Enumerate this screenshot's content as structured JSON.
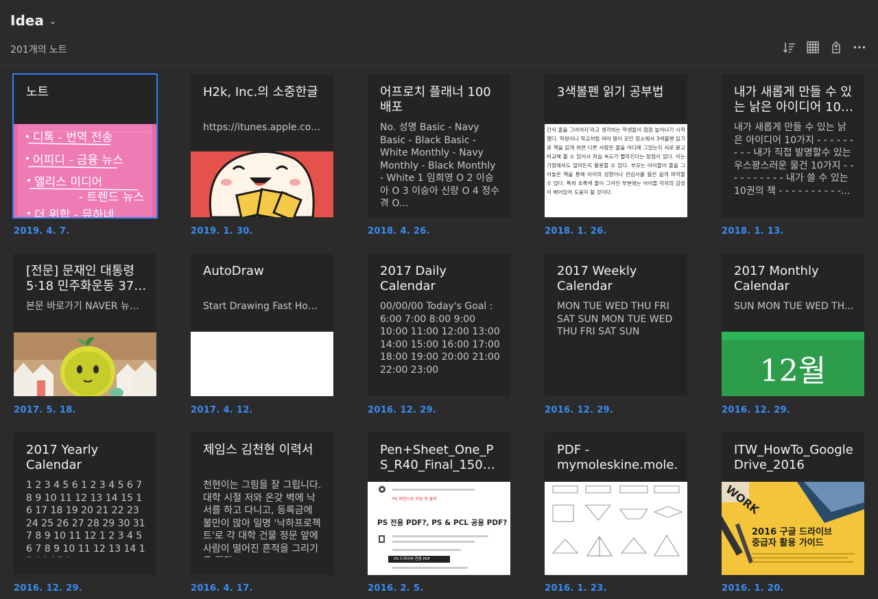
{
  "header": {
    "notebook": "Idea",
    "count": "201개의 노트"
  },
  "cards": [
    {
      "title": "노트",
      "snippet": "",
      "date": "2019. 4. 7."
    },
    {
      "title": "H2k, Inc.의 소중한글",
      "snippet": "https://itunes.apple.com...",
      "date": "2019. 1. 30."
    },
    {
      "title": "어프로치 플래너 100 배포",
      "snippet": "No. 성명 Basic - Navy Basic - Black Basic - White Monthly - Navy Monthly - Black Monthly - White 1 임희영 O 2 이승아 O 3 이승아 신랑 O 4 정수경 O...",
      "date": "2018. 4. 26."
    },
    {
      "title": "3색볼펜 읽기 공부법",
      "snippet": "",
      "date": "2018. 1. 26."
    },
    {
      "title": "내가 새롭게 만들 수 있는 낡은 아이디어 10…",
      "snippet": "내가 새롭게 만들 수 있는 낡은 아이디어 10가지 - - - - - - - - - 내가 직접 발명할수 있는 우스꽝스러운 물건 10가지 - - - - - - - - - - 내가 쓸 수 있는 10권의 책 - - - - - - - - - -...",
      "date": "2018. 1. 13."
    },
    {
      "title": "[전문] 문재인 대통령 5·18 민주화운동 37…",
      "snippet": "본문 바로가기 NAVER 뉴스...",
      "date": "2017. 5. 18."
    },
    {
      "title": "AutoDraw",
      "snippet": "Start Drawing Fast How-...",
      "date": "2017. 4. 12."
    },
    {
      "title": "2017 Daily Calendar",
      "snippet": "00/00/00 Today's Goal : 6:00 7:00 8:00 9:00 10:00 11:00 12:00 13:00 14:00 15:00 16:00 17:00 18:00 19:00 20:00 21:00 22:00 23:00",
      "date": "2016. 12. 29."
    },
    {
      "title": "2017 Weekly Calendar",
      "snippet": "MON TUE WED THU FRI SAT SUN MON TUE WED THU FRI SAT SUN",
      "date": "2016. 12. 29."
    },
    {
      "title": "2017 Monthly Calendar",
      "snippet": "SUN MON TUE WED TH...",
      "date": "2016. 12. 29."
    },
    {
      "title": "2017 Yearly Calendar",
      "snippet": "1 2 3 4 5 6 1 2 3 4 5 6 7 8 9 10 11 12 13 14 15 16 17 18 19 20 21 22 23 24 25 26 27 28 29 30 31 7 8 9 10 11 12 1 2 3 4 5 6 7 8 9 10 11 12 13 14 15 16 17 1...",
      "date": "2016. 12. 29."
    },
    {
      "title": "제임스 김천현 이력서",
      "snippet": "천현이는 그림을 잘 그립니다. 대학 시절 저와 온갖 벽에 낙서를 하고 다니고, 등록금에 불만이 많아 일명 '낙하프로젝트'로 각 대학 건물 정문 앞에 사람이 떨어진 흔적을 그리기도 했답...",
      "date": "2016. 4. 17."
    },
    {
      "title": "Pen+Sheet_One_PS_R40_Final_150114",
      "snippet": "",
      "date": "2016. 2. 5."
    },
    {
      "title": "PDF - mymoleskine.mole...",
      "snippet": "",
      "date": "2016. 1. 23."
    },
    {
      "title": "ITW_HowTo_Google Drive_2016",
      "snippet": "",
      "date": "2016. 1. 20."
    }
  ],
  "thumbs": {
    "sticky": {
      "lines": [
        "디톡 - 번역 전송",
        "어피디 - 금융 뉴스",
        "앨리스 미디어",
        "- 트렌드 뉴스",
        "더 위합 - 뮤하네"
      ]
    },
    "article": {
      "text": "간식 줄을 그어야지'라고 생각하는 학생들이 점점 늘어나기 시작했다. 학원이나 학교처럼 여러 명이 모인 장소에서 3색볼펜 읽기로 책을 읽게 하면 다른 사람은 줄을 어디에 그었는지 서로 묻고 비교해 볼 수 있어서 학습 속도가 빨라진다는 장점이 있다. 이는 가정에서도 얼마든지 활용할 수 있다. 부모는 아이들이 줄을 그어놓은 책을 통해 아이의 성향이나 관심사를 훨씬 쉽게 파악할 수 있다. 특히 초록색 줄이 그어진 부분에는 아이들 각자의 감성이 배어있어 도움이 될 것이다."
    },
    "month": {
      "label": "12월"
    },
    "pdf": {
      "link": "PS 버전으로 지정 후 출력",
      "heading": "PS 전용 PDF?, PS & PCL 공용 PDF?",
      "bar": "PS 드라이버 전용 PDF"
    },
    "drive": {
      "badge": "WORK",
      "line1": "2016 구글 드라이브",
      "line2": "중급자 활용 가이드"
    }
  }
}
